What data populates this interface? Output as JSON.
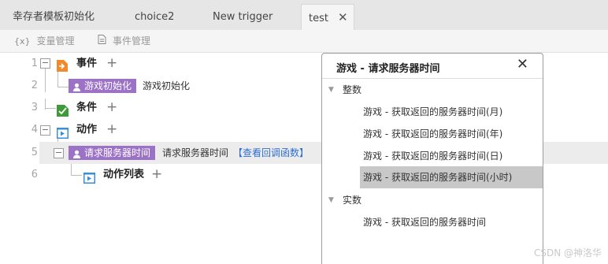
{
  "tabs": [
    {
      "label": "幸存者模板初始化"
    },
    {
      "label": "choice2"
    },
    {
      "label": "New trigger"
    },
    {
      "label": "test",
      "close": "✕"
    }
  ],
  "toolbar": {
    "var_icon": "{x}",
    "var_label": "变量管理",
    "event_label": "事件管理"
  },
  "tree": {
    "rows": [
      {
        "line": "1",
        "label": "事件",
        "plus": "+"
      },
      {
        "line": "2",
        "tag": "游戏初始化",
        "text": "游戏初始化"
      },
      {
        "line": "3",
        "label": "条件",
        "plus": "+"
      },
      {
        "line": "4",
        "label": "动作",
        "plus": "+"
      },
      {
        "line": "5",
        "tag": "请求服务器时间",
        "text": "请求服务器时间",
        "link": "【查看回调函数】"
      },
      {
        "line": "6",
        "label": "动作列表",
        "plus": "+"
      }
    ]
  },
  "popup": {
    "title": "游戏 - 请求服务器时间",
    "close": "✕",
    "groups": [
      {
        "label": "整数",
        "items": [
          "游戏 - 获取返回的服务器时间(月)",
          "游戏 - 获取返回的服务器时间(年)",
          "游戏 - 获取返回的服务器时间(日)",
          "游戏 - 获取返回的服务器时间(小时)"
        ],
        "selected_index": 3
      },
      {
        "label": "实数",
        "items": [
          "游戏 - 获取返回的服务器时间"
        ]
      }
    ]
  },
  "watermark": "CSDN @神洛华",
  "colors": {
    "tag": "#9b72c6",
    "link": "#2f6fd0",
    "event_icon": "#f08a2c",
    "cond_icon": "#3f9b3a",
    "action_icon": "#3a8fd6"
  }
}
